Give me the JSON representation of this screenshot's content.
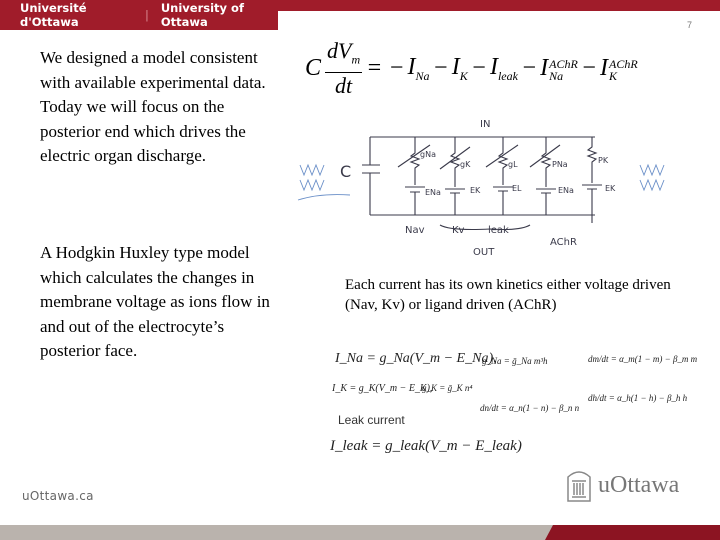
{
  "header": {
    "brand_fr": "Université d'Ottawa",
    "separator": "|",
    "brand_en": "University of Ottawa",
    "page_number": "7",
    "brand_color": "#a01c2a"
  },
  "left_column": {
    "paragraph1": "We designed a model consistent with available experimental data. Today we will focus on the posterior end which drives the electric organ discharge.",
    "paragraph2": "A Hodgkin Huxley type model which calculates the changes in membrane voltage as ions flow in and out of the electrocyte’s posterior face."
  },
  "main_equation": {
    "lhs_coef": "C",
    "numerator": "dV",
    "numerator_sub": "m",
    "denominator": "dt",
    "equals": "= −",
    "terms": [
      {
        "symbol": "I",
        "sub": "Na",
        "sup": ""
      },
      {
        "symbol": "I",
        "sub": "K",
        "sup": ""
      },
      {
        "symbol": "I",
        "sub": "leak",
        "sup": ""
      },
      {
        "symbol": "I",
        "sub": "Na",
        "sup": "AChR"
      },
      {
        "symbol": "I",
        "sub": "K",
        "sup": "AChR"
      }
    ]
  },
  "circuit": {
    "top_label": "IN",
    "bottom_label": "OUT",
    "capacitor_label": "C",
    "branch_labels": [
      "Nav",
      "Kv",
      "leak",
      "AChR"
    ],
    "conductances": [
      "gNa",
      "gK",
      "gL",
      "PNa",
      "PK"
    ],
    "reversals": [
      "ENa",
      "EK",
      "EL",
      "ENa",
      "EK"
    ]
  },
  "caption": "Each  current has its own kinetics either voltage driven (Nav, Kv) or ligand driven (AChR)",
  "equations": {
    "ina": "I_Na = g_Na(V_m − E_Na),",
    "gna": "g_Na = ḡ_Na m³h",
    "dm": "dm/dt = α_m(1 − m) − β_m m",
    "ik": "I_K = g_K(V_m − E_K),",
    "gk": "g_K = ḡ_K n⁴",
    "dn": "dn/dt = α_n(1 − n) − β_n n",
    "dh": "dh/dt = α_h(1 − h) − β_h h",
    "leak_label": "Leak current",
    "ileak": "I_leak = g_leak(V_m − E_leak)"
  },
  "footer": {
    "url": "uOttawa.ca",
    "logo_text": "uOttawa",
    "bar_grey": "#bab3ad",
    "bar_red": "#8c1422"
  }
}
